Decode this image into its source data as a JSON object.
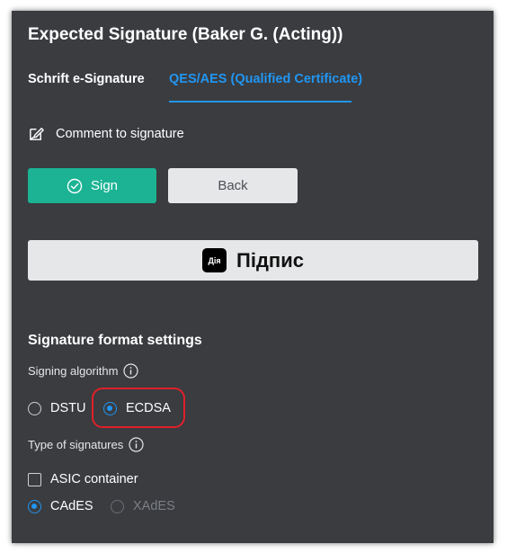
{
  "header": {
    "title": "Expected Signature (Baker G. (Acting))"
  },
  "tabs": [
    {
      "label": "Schrift e-Signature",
      "active": false
    },
    {
      "label": "QES/AES (Qualified Certificate)",
      "active": true
    }
  ],
  "comment": {
    "label": "Comment to signature",
    "icon": "edit-icon"
  },
  "actions": {
    "sign_label": "Sign",
    "sign_icon": "check-circle-icon",
    "back_label": "Back"
  },
  "diia": {
    "logo_text": "Дія",
    "label": "Підпис"
  },
  "settings": {
    "title": "Signature format settings",
    "algorithm": {
      "label": "Signing algorithm",
      "options": [
        {
          "label": "DSTU",
          "selected": false
        },
        {
          "label": "ECDSA",
          "selected": true
        }
      ]
    },
    "signature_type": {
      "label": "Type of signatures",
      "asic": {
        "label": "ASIC container",
        "checked": false
      },
      "formats": [
        {
          "label": "CAdES",
          "selected": true,
          "disabled": false
        },
        {
          "label": "XAdES",
          "selected": false,
          "disabled": true
        }
      ]
    }
  },
  "colors": {
    "panel_bg": "#3a3c40",
    "accent_blue": "#2196f3",
    "sign_green": "#1bb394",
    "highlight_red": "#e0202a"
  }
}
